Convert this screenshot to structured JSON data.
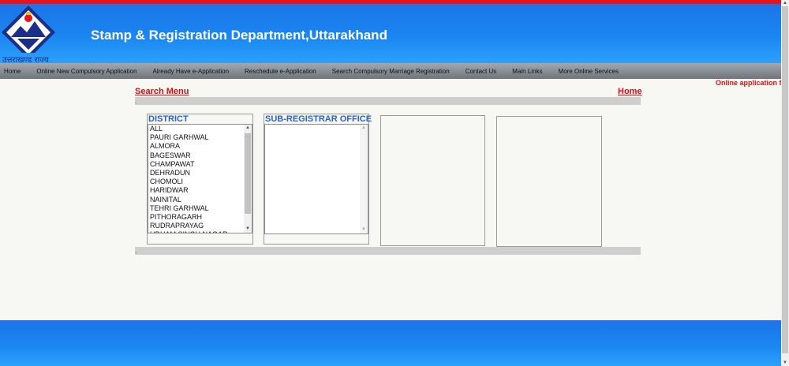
{
  "header": {
    "title": "Stamp & Registration Department,Uttarakhand",
    "logo_text": "उत्तराखण्ड राज्य"
  },
  "nav": [
    {
      "label": "Home"
    },
    {
      "label": "Online New Compulsory Application"
    },
    {
      "label": "Already Have e-Application"
    },
    {
      "label": "Reschedule e-Application"
    },
    {
      "label": "Search Compulsory Marriage Registration"
    },
    {
      "label": "Contact Us"
    },
    {
      "label": "Main Links"
    },
    {
      "label": "More Online Services"
    }
  ],
  "marquee": "Online application f",
  "links": {
    "search_menu": "Search Menu",
    "home": "Home"
  },
  "bars": {
    "dot": "."
  },
  "district": {
    "title": "DISTRICT",
    "items": [
      "ALL",
      "PAURI GARHWAL",
      "ALMORA",
      "BAGESWAR",
      "CHAMPAWAT",
      "DEHRADUN",
      "CHOMOLI",
      "HARIDWAR",
      "NAINITAL",
      "TEHRI GARHWAL",
      "PITHORAGARH",
      "RUDRAPRAYAG",
      "UDHAM SINGH NAGAR"
    ]
  },
  "sub_registrar": {
    "title": "SUB-REGISTRAR OFFICE",
    "items": []
  },
  "colors": {
    "brand_blue": "#1a86f0",
    "accent_red": "#e8141b",
    "link_red": "#d01010",
    "panel_title_blue": "#2a64c0"
  }
}
